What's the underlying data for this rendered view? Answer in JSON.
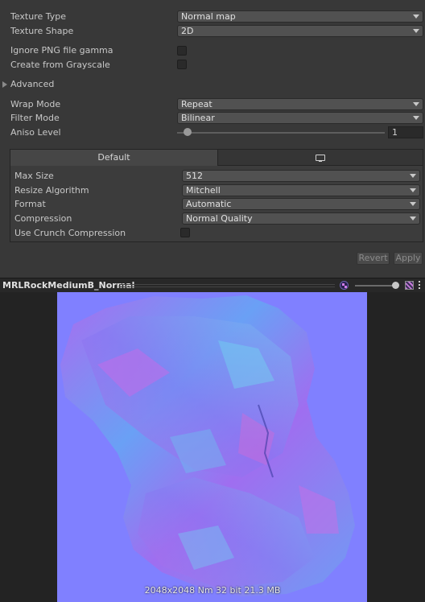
{
  "settings": {
    "texture_type": {
      "label": "Texture Type",
      "value": "Normal map"
    },
    "texture_shape": {
      "label": "Texture Shape",
      "value": "2D"
    },
    "ignore_png_gamma": {
      "label": "Ignore PNG file gamma",
      "checked": false
    },
    "create_from_grayscale": {
      "label": "Create from Grayscale",
      "checked": false
    },
    "advanced": {
      "label": "Advanced",
      "expanded": false
    },
    "wrap_mode": {
      "label": "Wrap Mode",
      "value": "Repeat"
    },
    "filter_mode": {
      "label": "Filter Mode",
      "value": "Bilinear"
    },
    "aniso_level": {
      "label": "Aniso Level",
      "value": "1",
      "fraction": 0.05
    }
  },
  "platform_tabs": {
    "default_label": "Default",
    "second_icon": "monitor-icon"
  },
  "platform_settings": {
    "max_size": {
      "label": "Max Size",
      "value": "512"
    },
    "resize_algorithm": {
      "label": "Resize Algorithm",
      "value": "Mitchell"
    },
    "format": {
      "label": "Format",
      "value": "Automatic"
    },
    "compression": {
      "label": "Compression",
      "value": "Normal Quality"
    },
    "crunch": {
      "label": "Use Crunch Compression",
      "checked": false
    }
  },
  "buttons": {
    "revert": "Revert",
    "apply": "Apply"
  },
  "preview": {
    "title": "MRLRockMediumB_Normal",
    "info": "2048x2048  Nm 32 bit   21.3 MB",
    "mip_fraction": 1.0
  },
  "colors": {
    "normal_flat": "#8080ff",
    "panel_bg": "#383838",
    "dropdown_bg": "#515151"
  }
}
